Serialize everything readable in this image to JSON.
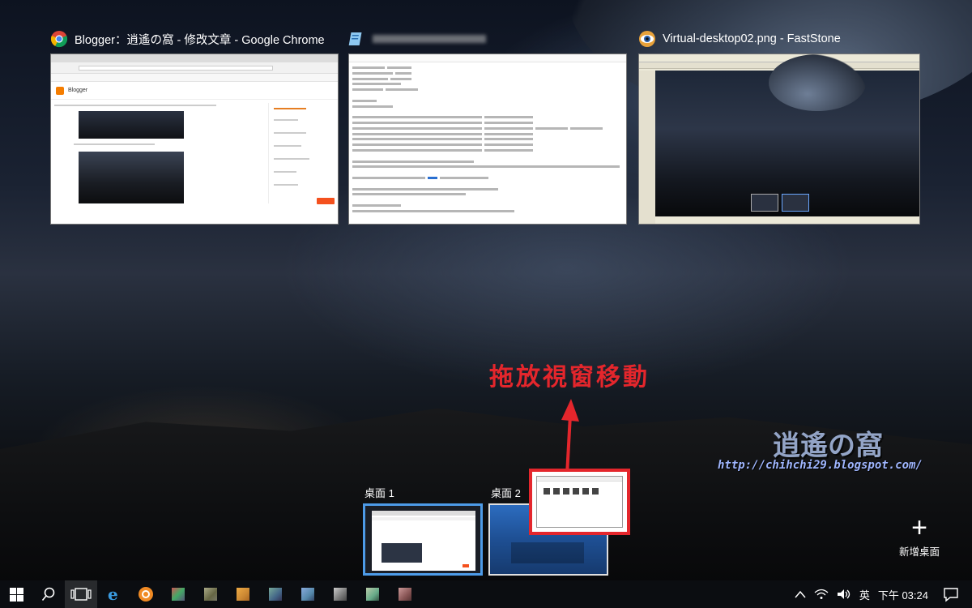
{
  "windows": [
    {
      "title": "Blogger：逍遙の窩 - 修改文章 - Google Chrome",
      "icon": "chrome-icon"
    },
    {
      "title": "",
      "icon": "notepad-icon"
    },
    {
      "title": "Virtual-desktop02.png - FastStone",
      "icon": "faststone-icon"
    }
  ],
  "chrome_thumb": {
    "blogger_name": "Blogger"
  },
  "annotation": {
    "text": "拖放視窗移動",
    "color": "#e4262c"
  },
  "watermark": {
    "logo": "逍遙の窩",
    "url": "http://chihchi29.blogspot.com/"
  },
  "desktops": [
    {
      "label": "桌面 1",
      "active": true
    },
    {
      "label": "桌面 2",
      "active": false
    }
  ],
  "new_desktop": {
    "label": "新增桌面"
  },
  "taskbar": {
    "items": [
      "windows-start-icon",
      "search-icon",
      "task-view-icon",
      "edge-icon",
      "app-icon-orange",
      "app-1",
      "app-2",
      "app-3",
      "app-4",
      "app-5",
      "app-6",
      "app-7"
    ]
  },
  "tray": {
    "ime": "英",
    "time": "下午 03:24"
  },
  "colors": {
    "accent": "#4d9be8",
    "annotation": "#e4262c"
  }
}
